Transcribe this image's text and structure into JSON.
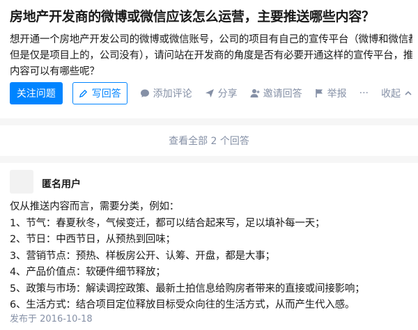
{
  "question": {
    "title": "房地产开发商的微博或微信应该怎么运营，主要推送哪些内容？",
    "detail_lines": [
      "想开通一个房地产开发公司的微博或微信账号，公司的项目有自己的宣传平台（微博和微信都有，",
      "但是仅是项目上的，公司没有），请问站在开发商的角度是否有必要开通这样的宣传平台，推送的",
      "内容可以有哪些呢？"
    ]
  },
  "actions": {
    "follow_label": "关注问题",
    "answer_label": "写回答",
    "comment_label": "添加评论",
    "share_label": "分享",
    "invite_label": "邀请回答",
    "report_label": "举报",
    "more_label": "···",
    "collapse_label": "收起"
  },
  "view_all": {
    "label": "查看全部 2 个回答"
  },
  "answer": {
    "author": "匿名用户",
    "lines": [
      "仅从推送内容而言，需要分类，例如：",
      "1、节气：春夏秋冬，气候变迁，都可以结合起来写，足以填补每一天；",
      "2、节日：中西节日，从预热到回味；",
      "3、营销节点：预热、样板房公开、认筹、开盘，都是大事；",
      "4、产品价值点：软硬件细节释放；",
      "5、政策与市场：解读调控政策、最新土拍信息给购房者带来的直接或间接影响；",
      "6、生活方式：结合项目定位释放目标受众向往的生活方式，从而产生代入感。"
    ],
    "published": "发布于 2016-10-18"
  },
  "colors": {
    "primary": "#0084ff",
    "meta": "#8590a6",
    "background": "#f6f6f6"
  }
}
